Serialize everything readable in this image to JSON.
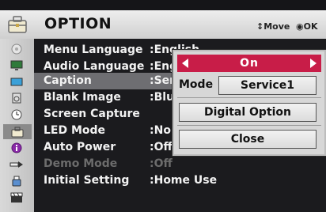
{
  "header": {
    "title": "OPTION",
    "hint_move": "↕Move",
    "hint_ok": "◉OK"
  },
  "sidebar": {
    "icons": [
      "picture-icon",
      "monitor-icon",
      "screen-icon",
      "speaker-icon",
      "clock-icon",
      "toolbox-icon",
      "info-icon",
      "input-icon",
      "usb-icon",
      "clapper-icon"
    ],
    "active": "toolbox-icon"
  },
  "menu": {
    "rows": [
      {
        "label": "Menu Language",
        "value": ":English"
      },
      {
        "label": "Audio Language",
        "value": ":Eng"
      },
      {
        "label": "Caption",
        "value": ":Ser"
      },
      {
        "label": "Blank Image",
        "value": ":Blu"
      },
      {
        "label": "Screen Capture",
        "value": ""
      },
      {
        "label": "LED Mode",
        "value": ":No"
      },
      {
        "label": "Auto Power",
        "value": ":Off"
      },
      {
        "label": "Demo Mode",
        "value": ":Off"
      },
      {
        "label": "Initial Setting",
        "value": ":Home Use"
      }
    ],
    "partial_char": "o"
  },
  "popup": {
    "selector_value": "On",
    "mode_label": "Mode",
    "mode_value": "Service1",
    "digital_option": "Digital Option",
    "close": "Close"
  },
  "colors": {
    "accent": "#c81d48",
    "selected_row": "#6e6e72",
    "background": "#1b1b1e"
  }
}
